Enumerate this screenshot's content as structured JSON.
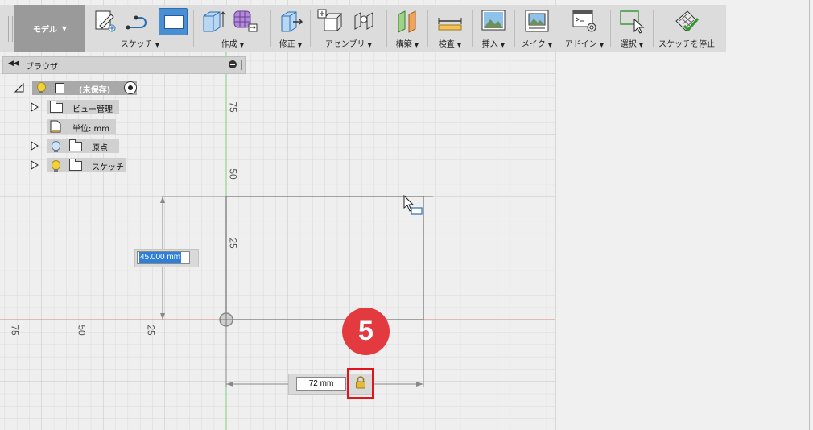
{
  "workspace": {
    "label": "モデル"
  },
  "toolbar": {
    "groups": [
      {
        "id": "sketch",
        "label": "スケッチ"
      },
      {
        "id": "create",
        "label": "作成"
      },
      {
        "id": "modify",
        "label": "修正"
      },
      {
        "id": "assemble",
        "label": "アセンブリ"
      },
      {
        "id": "construct",
        "label": "構築"
      },
      {
        "id": "inspect",
        "label": "検査"
      },
      {
        "id": "insert",
        "label": "挿入"
      },
      {
        "id": "make",
        "label": "メイク"
      },
      {
        "id": "addins",
        "label": "アドイン"
      },
      {
        "id": "select",
        "label": "選択"
      },
      {
        "id": "stop_sketch",
        "label": "スケッチを停止"
      }
    ]
  },
  "browser": {
    "title": "ブラウザ",
    "root": {
      "label": "(未保存)"
    },
    "items": [
      {
        "label": "ビュー管理",
        "icon": "folder-icon"
      },
      {
        "label": "単位: mm",
        "icon": "document-icon"
      },
      {
        "label": "原点",
        "icon": "folder-icon"
      },
      {
        "label": "スケッチ",
        "icon": "folder-icon"
      }
    ]
  },
  "canvas": {
    "vertical_ticks": [
      "75",
      "50",
      "25"
    ],
    "horizontal_ticks": [
      "75",
      "50",
      "25"
    ]
  },
  "dimensions": {
    "height_value": "45.000 mm",
    "width_value": "72 mm"
  },
  "step_badge": "5",
  "colors": {
    "accent_blue": "#4a8fd4",
    "badge_red": "#e23a3f",
    "x_axis": "#e08080",
    "y_axis": "#7ccf7c"
  }
}
